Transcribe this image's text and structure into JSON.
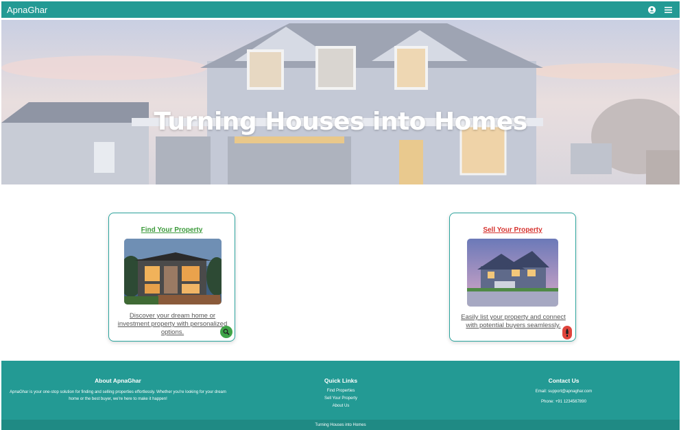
{
  "nav": {
    "brand": "ApnaGhar",
    "icons": [
      "user-circle-icon",
      "hamburger-menu-icon"
    ]
  },
  "hero": {
    "title": "Turning Houses into Homes"
  },
  "cards": {
    "find": {
      "title": "Find Your Property",
      "description": "Discover your dream home or investment property with personalized options.",
      "icon": "search-icon",
      "color": "#3b9a3a"
    },
    "sell": {
      "title": "Sell Your Property",
      "description": "Easily list your property and connect with potential buyers seamlessly.",
      "icon": "rocket-icon",
      "color": "#d6322e"
    }
  },
  "footer": {
    "about": {
      "heading": "About ApnaGhar",
      "text": "ApnaGhar is your one-stop solution for finding and selling properties effortlessly. Whether you're looking for your dream home or the best buyer, we're here to make it happen!"
    },
    "quick_links": {
      "heading": "Quick Links",
      "links": [
        "Find Properties",
        "Sell Your Property",
        "About Us"
      ]
    },
    "contact": {
      "heading": "Contact Us",
      "email": "Email: support@apnaghar.com",
      "phone": "Phone: +91 1234567890"
    },
    "bottom": "Turning Houses into Homes"
  },
  "colors": {
    "primary": "#239a94",
    "find_accent": "#3fa447",
    "sell_accent": "#e0443c"
  }
}
